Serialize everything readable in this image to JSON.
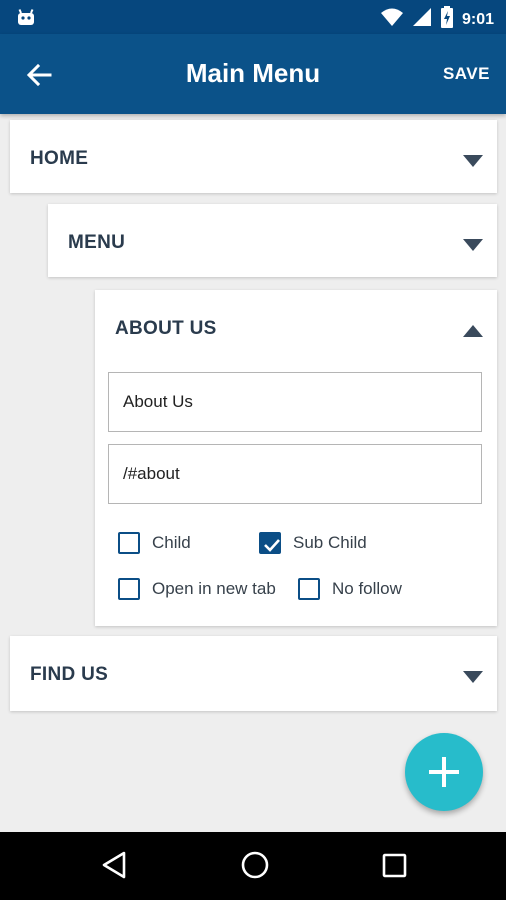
{
  "status_bar": {
    "time": "9:01",
    "icons": [
      "android-icon",
      "wifi-icon",
      "signal-icon",
      "battery-icon"
    ]
  },
  "app_bar": {
    "title": "Main Menu",
    "save_label": "SAVE",
    "back_icon": "arrow-left-icon"
  },
  "menu_items": [
    {
      "label": "HOME",
      "expanded": false
    },
    {
      "label": "MENU",
      "expanded": false
    },
    {
      "label": "ABOUT US",
      "expanded": true
    },
    {
      "label": "FIND US",
      "expanded": false
    }
  ],
  "about_us": {
    "title_value": "About Us",
    "url_value": "/#about",
    "checkboxes": [
      {
        "label": "Child",
        "checked": false
      },
      {
        "label": "Sub Child",
        "checked": true
      },
      {
        "label": "Open in new tab",
        "checked": false
      },
      {
        "label": "No follow",
        "checked": false
      }
    ]
  },
  "fab": {
    "icon": "plus-icon"
  },
  "nav_bar": {
    "icons": [
      "back-triangle-icon",
      "home-circle-icon",
      "recents-square-icon"
    ]
  },
  "colors": {
    "primary": "#0b5289",
    "status_bar": "#06477e",
    "accent": "#27bccb",
    "checkbox": "#0b4e86"
  }
}
